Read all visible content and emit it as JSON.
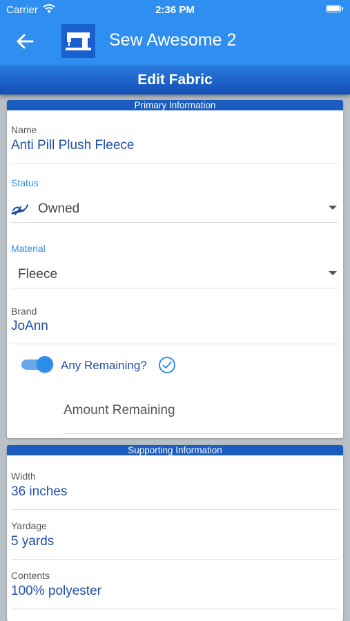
{
  "status_bar": {
    "carrier": "Carrier",
    "time": "2:36 PM"
  },
  "app": {
    "title": "Sew Awesome 2",
    "page_title": "Edit Fabric"
  },
  "primary": {
    "header": "Primary Information",
    "name": {
      "label": "Name",
      "value": "Anti Pill Plush Fleece"
    },
    "status": {
      "label": "Status",
      "value": "Owned"
    },
    "material": {
      "label": "Material",
      "value": "Fleece"
    },
    "brand": {
      "label": "Brand",
      "value": "JoAnn"
    },
    "remaining": {
      "label": "Any Remaining?",
      "enabled": true,
      "amount_placeholder": "Amount Remaining"
    }
  },
  "supporting": {
    "header": "Supporting Information",
    "width": {
      "label": "Width",
      "value": "36 inches"
    },
    "yardage": {
      "label": "Yardage",
      "value": "5 yards"
    },
    "contents": {
      "label": "Contents",
      "value": "100% polyester"
    }
  },
  "colors": {
    "accent": "#2e8ff0",
    "header_dark": "#1a5cbf",
    "value_text": "#1f4fa7"
  }
}
